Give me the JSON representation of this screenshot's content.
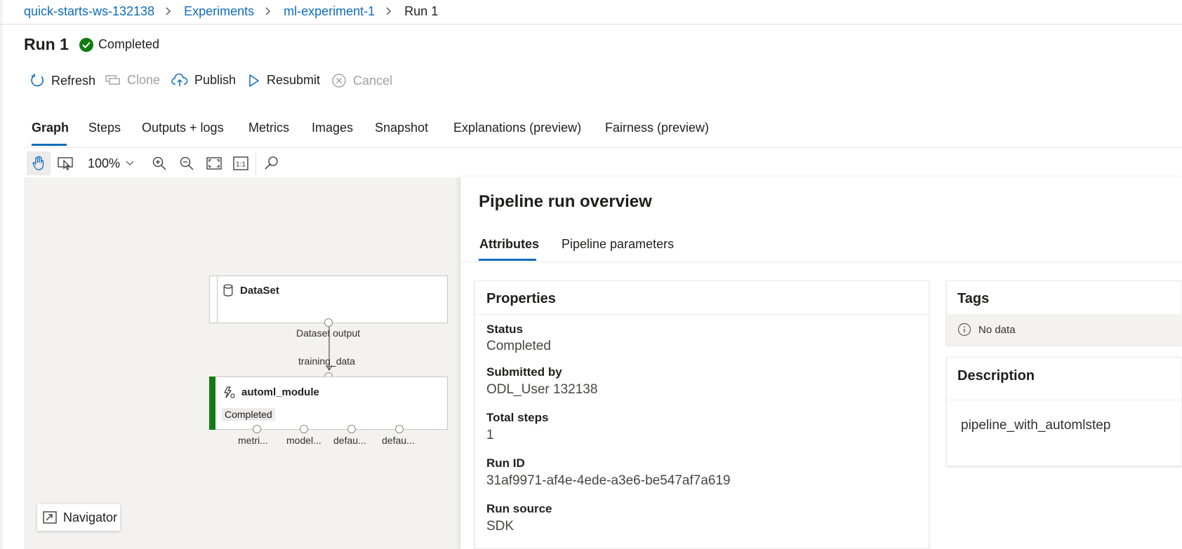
{
  "breadcrumb": {
    "items": [
      "quick-starts-ws-132138",
      "Experiments",
      "ml-experiment-1"
    ],
    "current": "Run 1"
  },
  "run": {
    "title": "Run 1",
    "status": "Completed"
  },
  "toolbar": {
    "refresh": "Refresh",
    "clone": "Clone",
    "publish": "Publish",
    "resubmit": "Resubmit",
    "cancel": "Cancel"
  },
  "tabs": [
    "Graph",
    "Steps",
    "Outputs + logs",
    "Metrics",
    "Images",
    "Snapshot",
    "Explanations (preview)",
    "Fairness (preview)"
  ],
  "graph_toolbar": {
    "zoom": "100%",
    "actual_size": "1:1"
  },
  "graph": {
    "dataset_node": {
      "title": "DataSet",
      "output_label": "Dataset output"
    },
    "edge_label": "training_data",
    "automl_node": {
      "title": "automl_module",
      "status": "Completed"
    },
    "output_ports": [
      "metri...",
      "model...",
      "defau...",
      "defau..."
    ],
    "navigator": "Navigator"
  },
  "overview": {
    "title": "Pipeline run overview",
    "tabs": [
      "Attributes",
      "Pipeline parameters"
    ],
    "properties": {
      "title": "Properties",
      "status_label": "Status",
      "status_value": "Completed",
      "submitted_by_label": "Submitted by",
      "submitted_by_value": "ODL_User 132138",
      "total_steps_label": "Total steps",
      "total_steps_value": "1",
      "run_id_label": "Run ID",
      "run_id_value": "31af9971-af4e-4ede-a3e6-be547af7a619",
      "run_source_label": "Run source",
      "run_source_value": "SDK"
    },
    "tags": {
      "title": "Tags",
      "empty": "No data"
    },
    "description": {
      "title": "Description",
      "text": "pipeline_with_automlstep"
    }
  },
  "colors": {
    "accent": "#0f6cbd",
    "success": "#107c10",
    "canvas": "#f3f2f1"
  }
}
